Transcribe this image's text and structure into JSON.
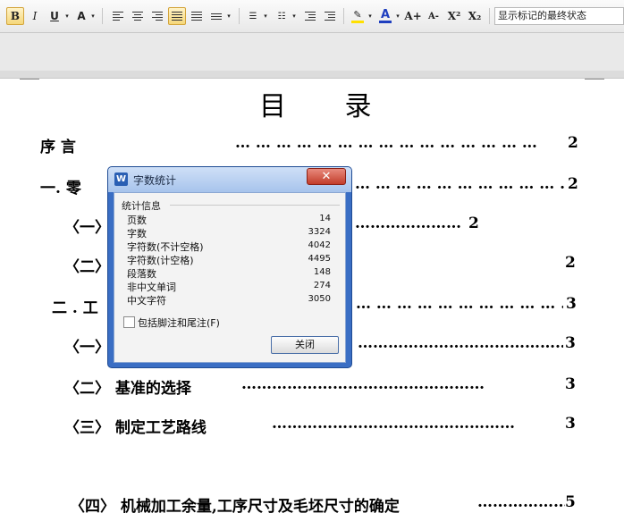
{
  "toolbar": {
    "bold": "B",
    "italic": "I",
    "underline": "U",
    "superscript": "X²",
    "subscript": "X₂",
    "grow_font": "A+",
    "shrink_font": "A-",
    "font_color_label": "A",
    "highlight_label": "✎",
    "revision_view": "显示标记的最终状态",
    "colors": {
      "font": "#1f3fbf",
      "highlight": "#ffe000"
    }
  },
  "document": {
    "title": "目  录",
    "toc": [
      {
        "text": "序          言",
        "dots": "… … … … … … … … … … … … … … …",
        "page": "2"
      },
      {
        "text": "一.  零",
        "dots": "… … … … … … … … … … … …",
        "page": "2"
      },
      {
        "text": "〈一〉",
        "dots": "…………………",
        "page": "2"
      },
      {
        "text": "〈二〉",
        "dots": "",
        "page": "2"
      },
      {
        "text": "二 . 工",
        "dots": "… … … … … … … … … … … …",
        "page": "3"
      },
      {
        "text": "〈一〉",
        "dots": "……………………………………",
        "page": "3"
      },
      {
        "text": "〈二〉   基准的选择",
        "dots": "…………………………………………",
        "page": "3"
      },
      {
        "text": "〈三〉   制定工艺路线",
        "dots": "…………………………………………",
        "page": "3"
      },
      {
        "text": "〈四〉   机械加工余量,工序尺寸及毛坯尺寸的确定",
        "dots": "………………",
        "page": "5"
      }
    ]
  },
  "dialog": {
    "title": "字数统计",
    "app_icon": "W",
    "close_glyph": "✕",
    "group_label": "统计信息",
    "stats": [
      {
        "label": "页数",
        "value": "14"
      },
      {
        "label": "字数",
        "value": "3324"
      },
      {
        "label": "字符数(不计空格)",
        "value": "4042"
      },
      {
        "label": "字符数(计空格)",
        "value": "4495"
      },
      {
        "label": "段落数",
        "value": "148"
      },
      {
        "label": "非中文单词",
        "value": "274"
      },
      {
        "label": "中文字符",
        "value": "3050"
      }
    ],
    "checkbox_label": "包括脚注和尾注(F)",
    "checkbox_checked": false,
    "close_button": "关闭"
  }
}
